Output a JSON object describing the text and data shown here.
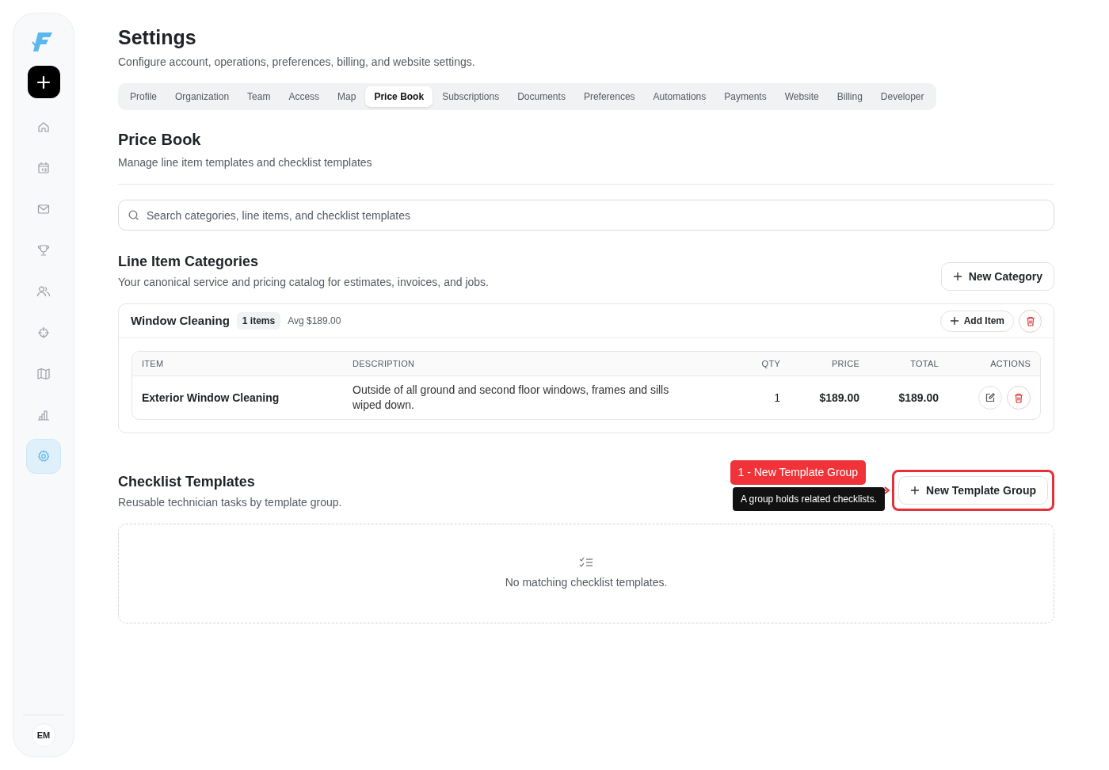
{
  "sidebar": {
    "items": [
      {
        "selected": false
      },
      {
        "selected": false
      },
      {
        "selected": false
      },
      {
        "selected": false
      },
      {
        "selected": false
      },
      {
        "selected": false
      },
      {
        "selected": false
      },
      {
        "selected": false
      },
      {
        "selected": true
      }
    ],
    "avatar": "EM"
  },
  "header": {
    "title": "Settings",
    "subtitle": "Configure account, operations, preferences, billing, and website settings."
  },
  "tabs": [
    {
      "label": "Profile",
      "selected": false
    },
    {
      "label": "Organization",
      "selected": false
    },
    {
      "label": "Team",
      "selected": false
    },
    {
      "label": "Access",
      "selected": false
    },
    {
      "label": "Map",
      "selected": false
    },
    {
      "label": "Price Book",
      "selected": true
    },
    {
      "label": "Subscriptions",
      "selected": false
    },
    {
      "label": "Documents",
      "selected": false
    },
    {
      "label": "Preferences",
      "selected": false
    },
    {
      "label": "Automations",
      "selected": false
    },
    {
      "label": "Payments",
      "selected": false
    },
    {
      "label": "Website",
      "selected": false
    },
    {
      "label": "Billing",
      "selected": false
    },
    {
      "label": "Developer",
      "selected": false
    }
  ],
  "section": {
    "title": "Price Book",
    "subtitle": "Manage line item templates and checklist templates"
  },
  "search": {
    "placeholder": "Search categories, line items, and checklist templates"
  },
  "categories": {
    "title": "Line Item Categories",
    "subtitle": "Your canonical service and pricing catalog for estimates, invoices, and jobs.",
    "new_button": "New Category",
    "groups": [
      {
        "name": "Window Cleaning",
        "count": "1 items",
        "avg": "Avg $189.00",
        "add_button": "Add Item",
        "columns": [
          "ITEM",
          "DESCRIPTION",
          "QTY",
          "PRICE",
          "TOTAL",
          "ACTIONS"
        ],
        "rows": [
          {
            "item": "Exterior Window Cleaning",
            "description": "Outside of all ground and second floor windows, frames and sills wiped down.",
            "qty": "1",
            "price": "$189.00",
            "total": "$189.00"
          }
        ]
      }
    ]
  },
  "checklists": {
    "title": "Checklist Templates",
    "subtitle": "Reusable technician tasks by template group.",
    "new_button": "New Template Group",
    "empty": "No matching checklist templates."
  },
  "tour": {
    "step": "1 - New Template Group",
    "tooltip": "A group holds related checklists."
  }
}
